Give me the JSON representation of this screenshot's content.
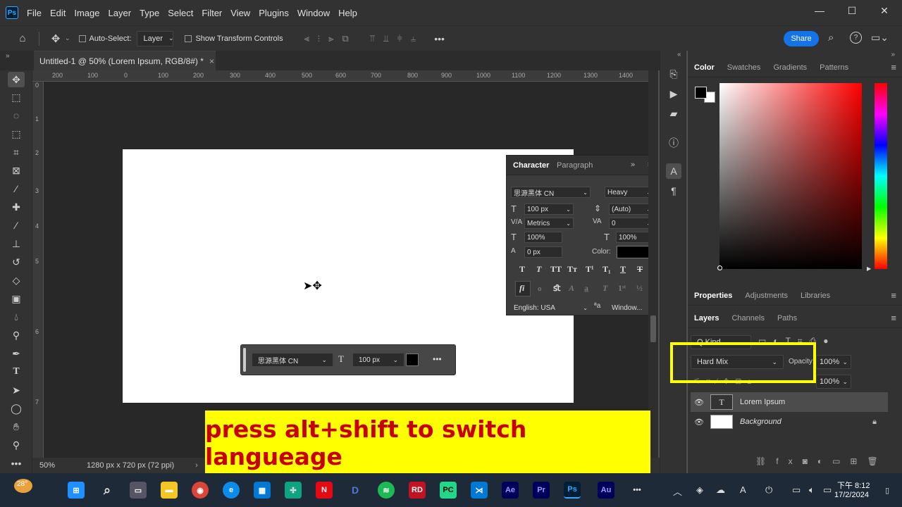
{
  "app": {
    "logo": "Ps"
  },
  "menubar": {
    "items": [
      "File",
      "Edit",
      "Image",
      "Layer",
      "Type",
      "Select",
      "Filter",
      "View",
      "Plugins",
      "Window",
      "Help"
    ]
  },
  "window_controls": {
    "minimize": "—",
    "maximize": "☐",
    "close": "✕"
  },
  "options_bar": {
    "auto_select_label": "Auto-Select:",
    "auto_select_value": "Layer",
    "transform_label": "Show Transform Controls",
    "share_label": "Share"
  },
  "document": {
    "tab_title": "Untitled-1 @ 50% (Lorem Ipsum, RGB/8#) *",
    "tab_close": "×",
    "zoom": "50%",
    "status_info": "1280 px x 720 px (72 ppi)"
  },
  "ruler_top": [
    "200",
    "100",
    "0",
    "100",
    "200",
    "300",
    "400",
    "500",
    "600",
    "700",
    "800",
    "900",
    "1000",
    "1100",
    "1200",
    "1300",
    "1400"
  ],
  "ruler_left": [
    "0",
    "1",
    "2",
    "3",
    "4",
    "5",
    "6",
    "7"
  ],
  "color_panel": {
    "tabs": [
      "Color",
      "Swatches",
      "Gradients",
      "Patterns"
    ],
    "fg": "#000000",
    "bg": "#ffffff"
  },
  "properties_panel": {
    "tabs": [
      "Properties",
      "Adjustments",
      "Libraries"
    ]
  },
  "layers_panel": {
    "tabs": [
      "Layers",
      "Channels",
      "Paths"
    ],
    "kind_label": "Q Kind",
    "blend_mode": "Hard Mix",
    "opacity_label": "Opacity:",
    "opacity_value": "100%",
    "fill_value": "100%",
    "layers": [
      {
        "name": "Lorem Ipsum",
        "type": "text",
        "visible": true,
        "selected": true
      },
      {
        "name": "Background",
        "type": "pixel",
        "visible": true,
        "locked": true
      }
    ]
  },
  "character_panel": {
    "tabs": [
      "Character",
      "Paragraph"
    ],
    "font_family": "思源黑体 CN",
    "font_style": "Heavy",
    "size": "100 px",
    "leading": "(Auto)",
    "kerning": "Metrics",
    "tracking": "0",
    "vscale": "100%",
    "hscale": "100%",
    "baseline": "0 px",
    "color_label": "Color:",
    "color_value": "#000000",
    "language": "English: USA",
    "aa_method": "Window..."
  },
  "floating_bar": {
    "font_family": "思源黑体 CN",
    "size": "100 px",
    "color": "#000000",
    "more": "•••"
  },
  "banner": {
    "text": "press alt+shift to switch langueage"
  },
  "taskbar": {
    "apps": [
      "Ae",
      "Pr",
      "Ps",
      "Au"
    ],
    "time": "下午 8:12",
    "date": "17/2/2024",
    "weather": "28°"
  }
}
